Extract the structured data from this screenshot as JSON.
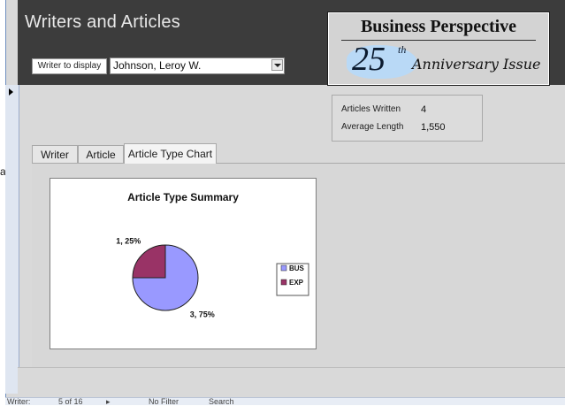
{
  "form": {
    "title": "Writers and Articles"
  },
  "filter": {
    "label": "Writer to display",
    "value": "Johnson, Leroy W."
  },
  "banner": {
    "title": "Business Perspective",
    "number": "25",
    "suffix": "th",
    "subtitle": "Anniversary Issue"
  },
  "stats": {
    "articles_label": "Articles Written",
    "articles_value": "4",
    "length_label": "Average Length",
    "length_value": "1,550"
  },
  "tabs": [
    {
      "label": "Writer",
      "active": false
    },
    {
      "label": "Article",
      "active": false
    },
    {
      "label": "Article Type Chart",
      "active": true
    }
  ],
  "chart_data": {
    "type": "pie",
    "title": "Article Type Summary",
    "categories": [
      "BUS",
      "EXP"
    ],
    "values": [
      3,
      1
    ],
    "percents": [
      75,
      25
    ],
    "data_labels": [
      "3, 75%",
      "1, 25%"
    ],
    "colors": [
      "#9999ff",
      "#993366"
    ],
    "legend_position": "right"
  },
  "navigation": {
    "record_label": "Writer:",
    "position": "5 of 16",
    "filter_status": "No Filter",
    "search_placeholder": "Search"
  },
  "side_fragment": "a"
}
